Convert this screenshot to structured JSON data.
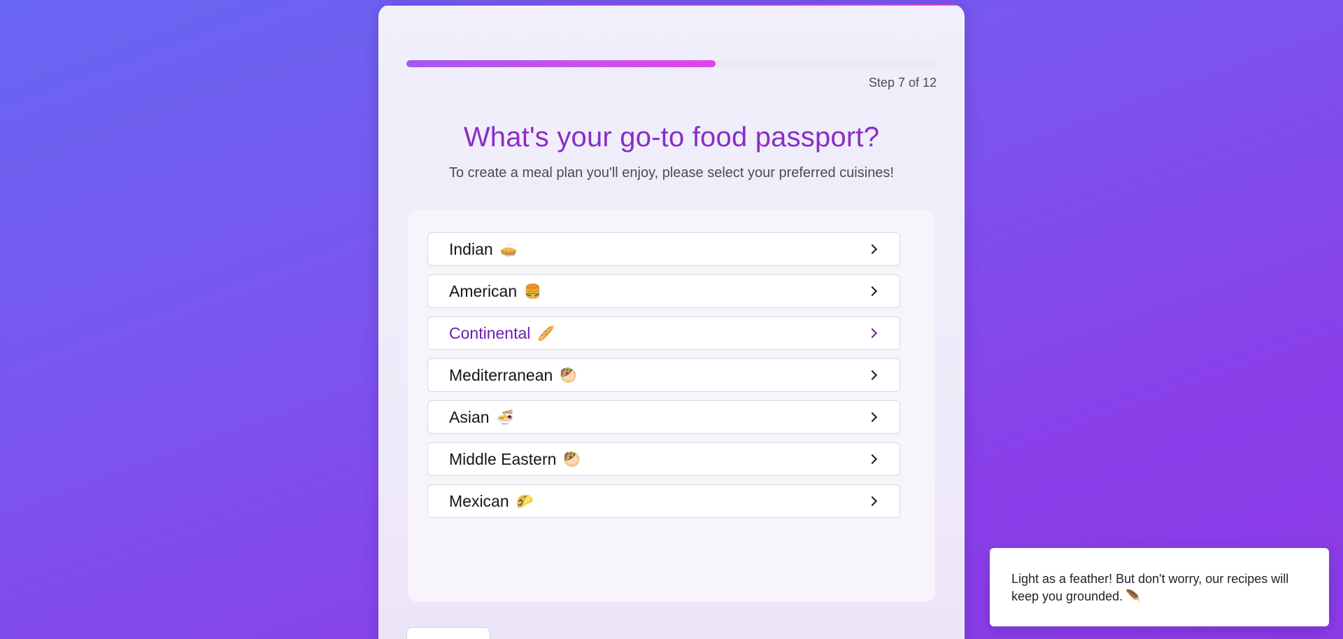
{
  "progress": {
    "current_step": 7,
    "total_steps": 12,
    "fraction": 0.583,
    "step_label": "Step 7 of 12"
  },
  "question": {
    "title": "What's your go-to food passport?",
    "subtitle": "To create a meal plan you'll enjoy, please select your preferred cuisines!"
  },
  "options": [
    {
      "label": "Indian",
      "emoji": "🥧",
      "active": false
    },
    {
      "label": "American",
      "emoji": "🍔",
      "active": false
    },
    {
      "label": "Continental",
      "emoji": "🥖",
      "active": true
    },
    {
      "label": "Mediterranean",
      "emoji": "🥙",
      "active": false
    },
    {
      "label": "Asian",
      "emoji": "🍜",
      "active": false
    },
    {
      "label": "Middle Eastern",
      "emoji": "🥙",
      "active": false
    },
    {
      "label": "Mexican",
      "emoji": "🌮",
      "active": false
    }
  ],
  "toast": {
    "text": "Light as a feather! But don't worry, our recipes will keep you grounded.",
    "emoji": "🪶"
  },
  "colors": {
    "accent": "#8a2dc6",
    "active_option": "#6b1fb0",
    "progress_start": "#a159f0",
    "progress_end": "#e044ea"
  }
}
